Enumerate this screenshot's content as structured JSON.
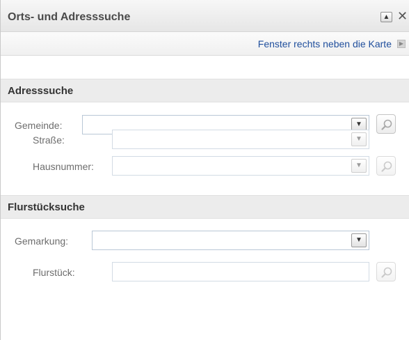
{
  "window": {
    "title": "Orts- und Adresssuche",
    "collapse_icon": "▲",
    "close_icon": "✕"
  },
  "toolbar": {
    "dock_label": "Fenster rechts neben die Karte"
  },
  "address_search": {
    "header": "Adresssuche",
    "gemeinde_label": "Gemeinde:",
    "gemeinde_value": "",
    "strasse_label": "Straße:",
    "strasse_value": "",
    "hausnummer_label": "Hausnummer:",
    "hausnummer_value": ""
  },
  "parcel_search": {
    "header": "Flurstücksuche",
    "gemarkung_label": "Gemarkung:",
    "gemarkung_value": "",
    "flurstueck_label": "Flurstück:",
    "flurstueck_value": ""
  }
}
